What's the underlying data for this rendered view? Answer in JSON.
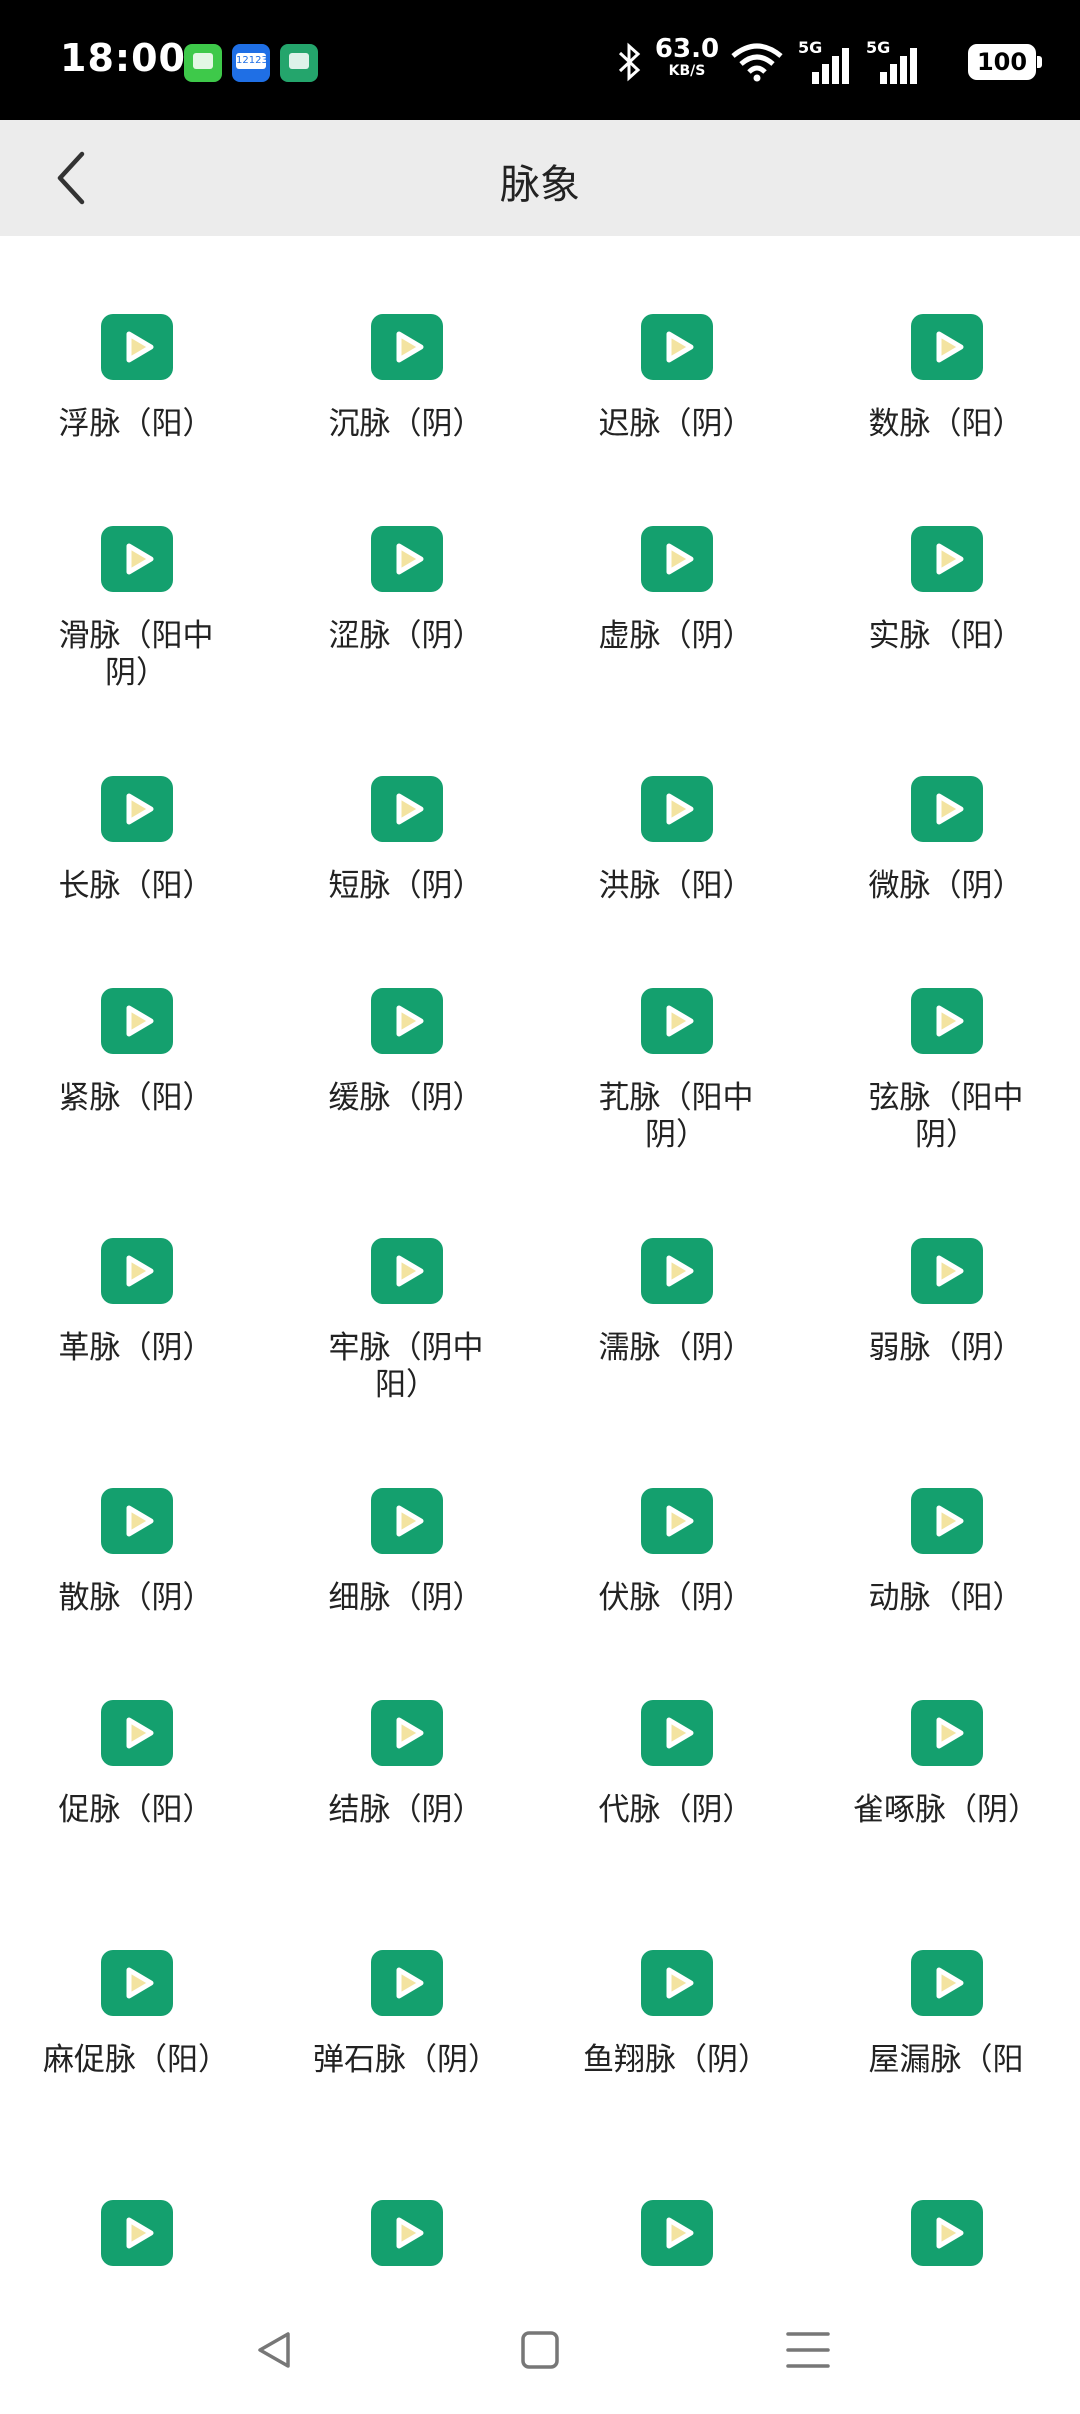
{
  "status_bar": {
    "time": "18:00",
    "net_speed": "63.0",
    "net_speed_unit": "KB/S",
    "sim1_label": "5G",
    "sim2_label": "5G",
    "battery": "100",
    "app_icons": [
      "messages-app-icon",
      "12123-app-icon",
      "wifi-app-icon"
    ]
  },
  "header": {
    "title": "脉象",
    "back_icon": "chevron-left-icon"
  },
  "colors": {
    "accent": "#14a06e",
    "play_triangle": "#f3e3a0"
  },
  "pulses": [
    {
      "label": "浮脉（阳）"
    },
    {
      "label": "沉脉（阴）"
    },
    {
      "label": "迟脉（阴）"
    },
    {
      "label": "数脉（阳）"
    },
    {
      "label": "滑脉（阳中阴）"
    },
    {
      "label": "涩脉（阴）"
    },
    {
      "label": "虚脉（阴）"
    },
    {
      "label": "实脉（阳）"
    },
    {
      "label": "长脉（阳）"
    },
    {
      "label": "短脉（阴）"
    },
    {
      "label": "洪脉（阳）"
    },
    {
      "label": "微脉（阴）"
    },
    {
      "label": "紧脉（阳）"
    },
    {
      "label": "缓脉（阴）"
    },
    {
      "label": "芤脉（阳中阴）"
    },
    {
      "label": "弦脉（阳中阴）"
    },
    {
      "label": "革脉（阴）"
    },
    {
      "label": "牢脉（阴中阳）"
    },
    {
      "label": "濡脉（阴）"
    },
    {
      "label": "弱脉（阴）"
    },
    {
      "label": "散脉（阴）"
    },
    {
      "label": "细脉（阴）"
    },
    {
      "label": "伏脉（阴）"
    },
    {
      "label": "动脉（阳）"
    },
    {
      "label": "促脉（阳）"
    },
    {
      "label": "结脉（阴）"
    },
    {
      "label": "代脉（阴）"
    },
    {
      "label": "雀啄脉（阴）"
    },
    {
      "label": "麻促脉（阳）"
    },
    {
      "label": "弹石脉（阴）"
    },
    {
      "label": "鱼翔脉（阴）"
    },
    {
      "label": "屋漏脉（阳"
    },
    {
      "label": ""
    },
    {
      "label": ""
    },
    {
      "label": ""
    },
    {
      "label": ""
    }
  ],
  "nav_bar": {
    "back_icon": "triangle-back-icon",
    "home_icon": "square-home-icon",
    "menu_icon": "menu-lines-icon"
  }
}
